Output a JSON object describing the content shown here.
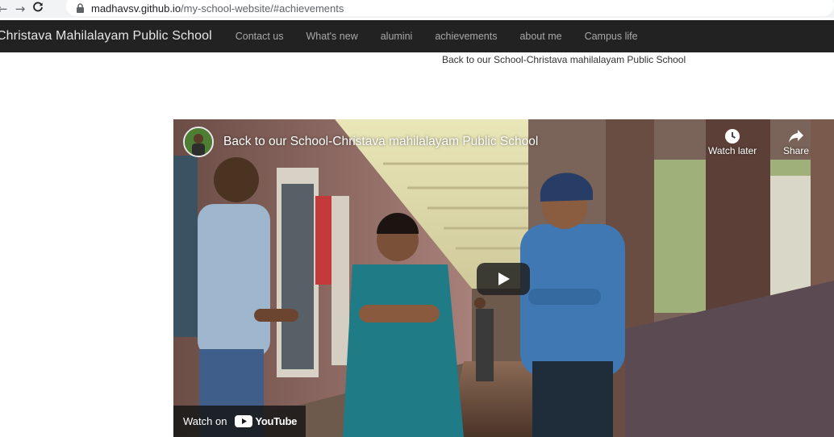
{
  "browser": {
    "url_host": "madhavsv.github.io",
    "url_path": "/my-school-website/#achievements"
  },
  "navbar": {
    "brand": "Christava Mahilalayam Public School",
    "links": [
      "Contact us",
      "What's new",
      "alumini",
      "achievements",
      "about me",
      "Campus life"
    ]
  },
  "caption": "Back to our School-Christava mahilalayam Public School",
  "video": {
    "title": "Back to our School-Christava mahilalayam Public School",
    "watch_later": "Watch later",
    "share": "Share",
    "watch_on": "Watch on",
    "youtube": "YouTube"
  }
}
